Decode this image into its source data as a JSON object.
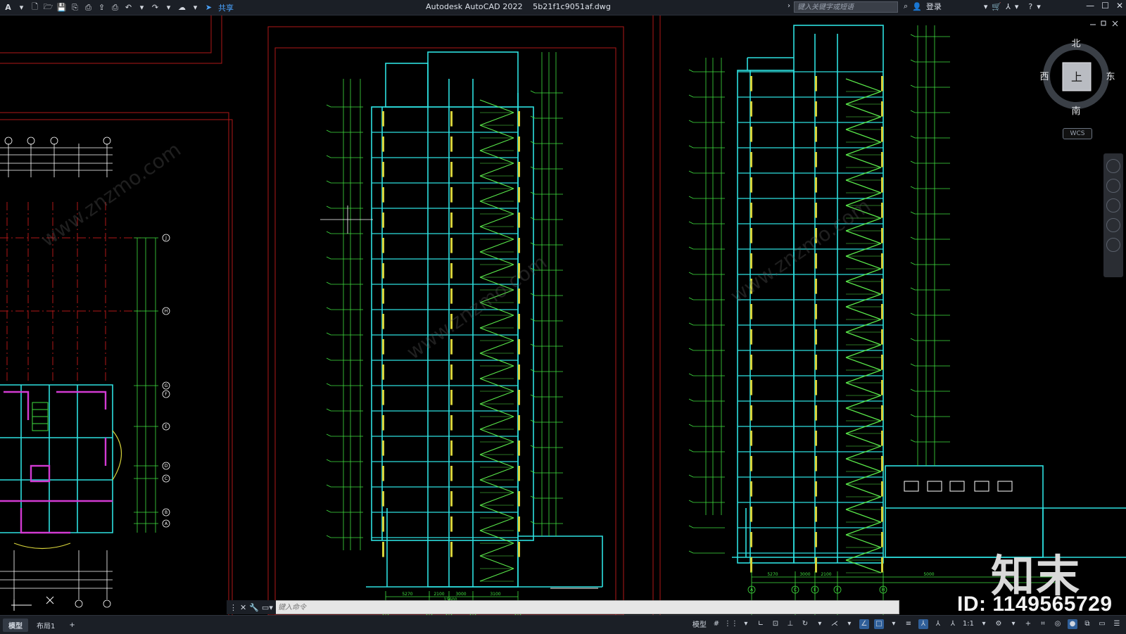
{
  "app": {
    "title": "Autodesk AutoCAD 2022",
    "filename": "5b21f1c9051af.dwg",
    "share_label": "共享",
    "search_placeholder": "键入关键字或短语",
    "login_label": "登录"
  },
  "viewcube": {
    "north": "北",
    "south": "南",
    "east": "东",
    "west": "西",
    "top": "上",
    "wcs": "WCS"
  },
  "command": {
    "placeholder": "键入命令"
  },
  "layouts": [
    {
      "label": "模型",
      "active": true
    },
    {
      "label": "布局1",
      "active": false
    }
  ],
  "add_tab": "+",
  "status": {
    "model_label": "模型",
    "scale_label": "1:1"
  },
  "watermark": {
    "logo": "知末",
    "id": "ID: 1149565729",
    "site": "www.znzmo.com"
  },
  "drawing": {
    "grid_labels_left": [
      "J",
      "H",
      "G",
      "F",
      "E",
      "D",
      "C",
      "B",
      "A"
    ],
    "column_labels_mid": [
      "A",
      "C",
      "E",
      "F",
      "H"
    ],
    "column_labels_right": [
      "A",
      "C",
      "E",
      "F",
      "H"
    ],
    "dims_mid": [
      "5270",
      "2100",
      "3000",
      "3100"
    ],
    "dims_total_mid": "15600",
    "dims_right": [
      "5270",
      "3000",
      "2100",
      "5000"
    ],
    "plan_dims_top": [
      "8800",
      "2700",
      "2700",
      "2700",
      "3600"
    ]
  },
  "colors": {
    "accent_cyan": "#2de0e0",
    "dim_green": "#3fe03f",
    "stair_green": "#59e84a",
    "hatch_yellow": "#d6d23a",
    "frame_red": "#b01818",
    "wall_magenta": "#d23ad2"
  }
}
